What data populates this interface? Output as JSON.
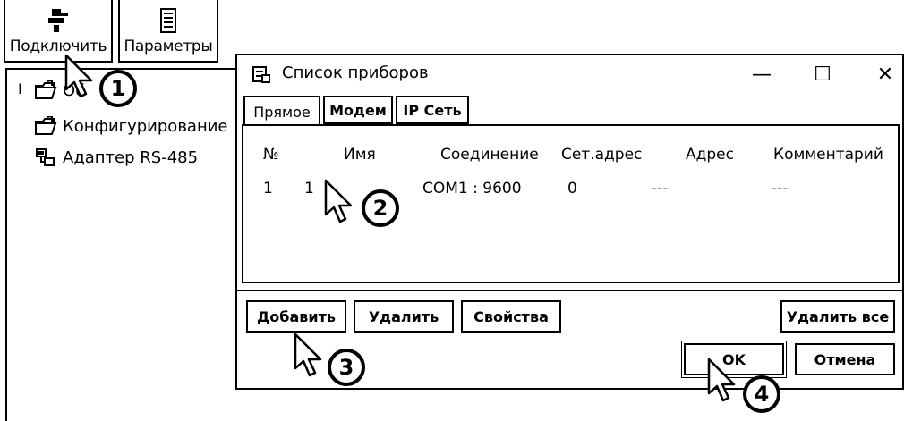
{
  "toolbar": {
    "connect_label": "Подключить",
    "params_label": "Параметры"
  },
  "tree": {
    "expander": "I",
    "items": [
      {
        "label": "Об",
        "icon": "folder-open-icon"
      },
      {
        "label": "Конфигурирование",
        "icon": "folder-open-icon"
      },
      {
        "label": "Адаптер RS-485",
        "icon": "adapter-icon"
      }
    ]
  },
  "dialog": {
    "title": "Список приборов",
    "controls": {
      "minimize": "—",
      "maximize": "☐",
      "close": "✕"
    },
    "tabs": [
      {
        "label": "Прямое",
        "active": true
      },
      {
        "label": "Модем",
        "active": false
      },
      {
        "label": "IP Сеть",
        "active": false
      }
    ],
    "table": {
      "columns": [
        "№",
        "Имя",
        "Соединение",
        "Сет.адрес",
        "Адрес",
        "Комментарий"
      ],
      "rows": [
        {
          "num": "1",
          "name": "1",
          "connection": "COM1 : 9600",
          "net_address": "0",
          "address": "---",
          "comment": "---"
        }
      ]
    },
    "buttons": {
      "add": "Добавить",
      "delete": "Удалить",
      "properties": "Свойства",
      "delete_all": "Удалить все",
      "ok": "OK",
      "cancel": "Отмена"
    }
  },
  "annotations": [
    "1",
    "2",
    "3",
    "4"
  ]
}
